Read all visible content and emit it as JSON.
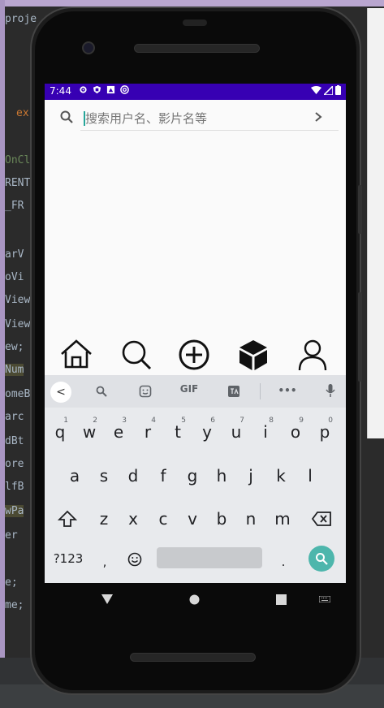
{
  "ide": {
    "code_lines": [
      "proje",
      "ex",
      "OnCl",
      "RENT",
      "_FR",
      "arV",
      "oVi",
      "View",
      "View",
      "ew;",
      "Num",
      "omeB",
      "arc",
      "dBt",
      "ore",
      "lfB",
      "wPa",
      "er",
      "e;",
      "me;"
    ]
  },
  "status_bar": {
    "time": "7:44"
  },
  "search": {
    "placeholder": "搜索用户名、影片名等",
    "search_icon": "search-icon",
    "go_icon": "chevron-right-icon"
  },
  "bottom_nav": {
    "items": [
      {
        "name": "home",
        "icon": "home-icon"
      },
      {
        "name": "search",
        "icon": "search-icon"
      },
      {
        "name": "add",
        "icon": "plus-circle-icon"
      },
      {
        "name": "box",
        "icon": "cube-icon"
      },
      {
        "name": "profile",
        "icon": "person-icon"
      }
    ]
  },
  "keyboard": {
    "toolbar": {
      "back": "<",
      "gif": "GIF",
      "more": "•••"
    },
    "row1": [
      {
        "k": "q",
        "n": "1"
      },
      {
        "k": "w",
        "n": "2"
      },
      {
        "k": "e",
        "n": "3"
      },
      {
        "k": "r",
        "n": "4"
      },
      {
        "k": "t",
        "n": "5"
      },
      {
        "k": "y",
        "n": "6"
      },
      {
        "k": "u",
        "n": "7"
      },
      {
        "k": "i",
        "n": "8"
      },
      {
        "k": "o",
        "n": "9"
      },
      {
        "k": "p",
        "n": "0"
      }
    ],
    "row2": [
      "a",
      "s",
      "d",
      "f",
      "g",
      "h",
      "j",
      "k",
      "l"
    ],
    "row3": [
      "z",
      "x",
      "c",
      "v",
      "b",
      "n",
      "m"
    ],
    "bottom": {
      "sym": "?123",
      "comma": ",",
      "period": "."
    }
  },
  "colors": {
    "status_bar": "#3700b3",
    "accent": "#26a69a",
    "go_key": "#4db6ac"
  }
}
